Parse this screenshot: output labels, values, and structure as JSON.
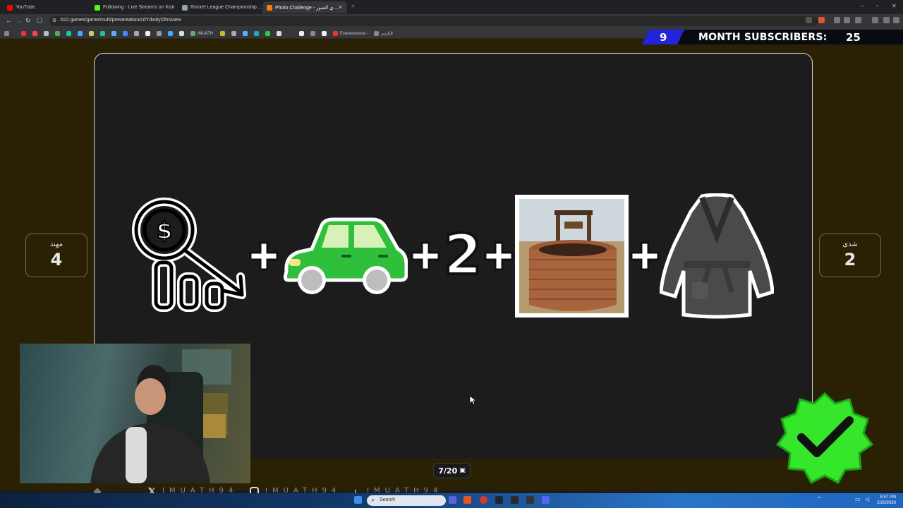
{
  "browser": {
    "tabs": [
      {
        "label": "YouTube",
        "color": "#ff0000"
      },
      {
        "label": "Following - Live Streams on Kick",
        "color": "#53fc18"
      },
      {
        "label": "Rocket League Championship Series",
        "color": "#9aa0a6"
      },
      {
        "label": "Photo Challenge - تحدي الصور",
        "color": "#ff7a00",
        "active": true
      }
    ],
    "url": "b22.games/game/multi/presentation/cdYdw8yOhn/view",
    "bookmarks": [
      "iMUATH",
      "Evanescence -",
      "البارتير"
    ]
  },
  "overlay": {
    "subscribers": {
      "count": "9",
      "label": "MONTH SUBSCRIBERS:",
      "goal": "25"
    },
    "social_handle": "IMUATH94"
  },
  "game": {
    "left_player": {
      "name": "مهند",
      "score": "4"
    },
    "right_player": {
      "name": "شدى",
      "score": "2"
    },
    "puzzle": [
      "price-drop-icon",
      "green-car-icon",
      "2",
      "water-well-photo",
      "bathrobe-icon"
    ],
    "digit": "2",
    "progress": "7/20"
  },
  "taskbar": {
    "search_label": "Search",
    "time": "8:57 PM",
    "date": "2/20/2026"
  }
}
